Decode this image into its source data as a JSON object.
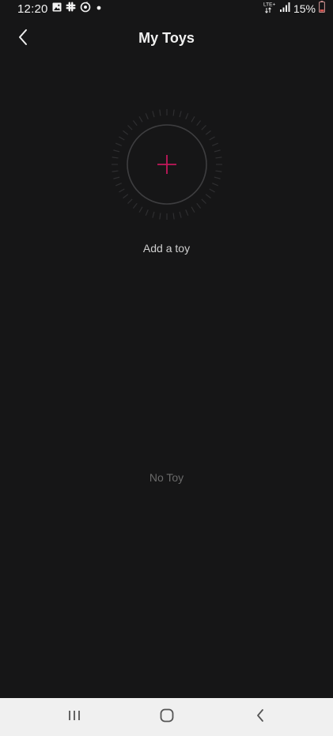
{
  "status_bar": {
    "time": "12:20",
    "battery": "15%",
    "network_label": "LTE+",
    "left_icons": [
      "gallery-icon",
      "slack-icon",
      "sync-icon",
      "dot-icon"
    ],
    "right_icons": [
      "lte-icon",
      "signal-icon",
      "battery-low-icon"
    ]
  },
  "header": {
    "title": "My Toys",
    "back_icon": "chevron-left-icon"
  },
  "add_toy": {
    "label": "Add a toy",
    "icon": "plus-icon",
    "accent_color": "#c2185b"
  },
  "empty_state": {
    "text": "No Toy"
  },
  "navigation_bar": {
    "buttons": [
      "recent-apps-icon",
      "home-icon",
      "back-icon"
    ]
  },
  "colors": {
    "background": "#161617",
    "nav_background": "#f0f0f0"
  }
}
